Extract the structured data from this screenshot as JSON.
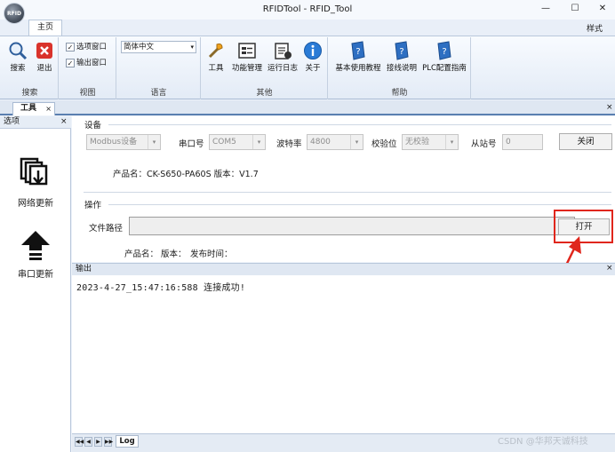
{
  "app": {
    "logo_text": "RFID",
    "title": "RFIDTool - RFID_Tool",
    "window_controls": [
      "—",
      "☐",
      "✕"
    ]
  },
  "ribbon": {
    "tabs": [
      "主页"
    ],
    "style_menu": "样式",
    "groups": {
      "search": {
        "label": "搜索",
        "buttons": [
          "搜索",
          "退出"
        ]
      },
      "view": {
        "label": "视图",
        "checks": [
          {
            "label": "选项窗口",
            "checked": true
          },
          {
            "label": "输出窗口",
            "checked": true
          }
        ]
      },
      "language": {
        "label": "语言",
        "selected": "简体中文"
      },
      "other": {
        "label": "其他",
        "buttons": [
          "工具",
          "功能管理",
          "运行日志",
          "关于"
        ]
      },
      "help": {
        "label": "帮助",
        "buttons": [
          "基本使用教程",
          "接线说明",
          "PLC配置指南"
        ]
      }
    }
  },
  "doc_tab": {
    "label": "工具",
    "close": "×"
  },
  "left_panel": {
    "title": "选项",
    "close": "×",
    "items": [
      "网络更新",
      "串口更新"
    ]
  },
  "device": {
    "section_title": "设备",
    "protocol": "Modbus设备",
    "port_label": "串口号",
    "port": "COM5",
    "baud_label": "波特率",
    "baud": "4800",
    "parity_label": "校验位",
    "parity": "无校验",
    "slave_label": "从站号",
    "slave": "0",
    "close_button": "关闭",
    "product_info": "产品名：CK-S650-PA60S  版本：V1.7"
  },
  "operation": {
    "section_title": "操作",
    "file_path_label": "文件路径",
    "file_path_value": "",
    "open_button": "打开",
    "product_label": "产品名：",
    "version_label": "版本：",
    "release_label": "发布时间："
  },
  "output": {
    "title": "输出",
    "close": "×",
    "lines": [
      "2023-4-27_15:47:16:588  连接成功!"
    ],
    "tabs": [
      "Log"
    ],
    "nav_arrows": [
      "◀◀",
      "◀",
      "▶",
      "▶▶"
    ]
  },
  "watermark": "CSDN @华邦天诚科技",
  "colors": {
    "accent": "#5a7fb0",
    "highlight": "#e0261c"
  }
}
